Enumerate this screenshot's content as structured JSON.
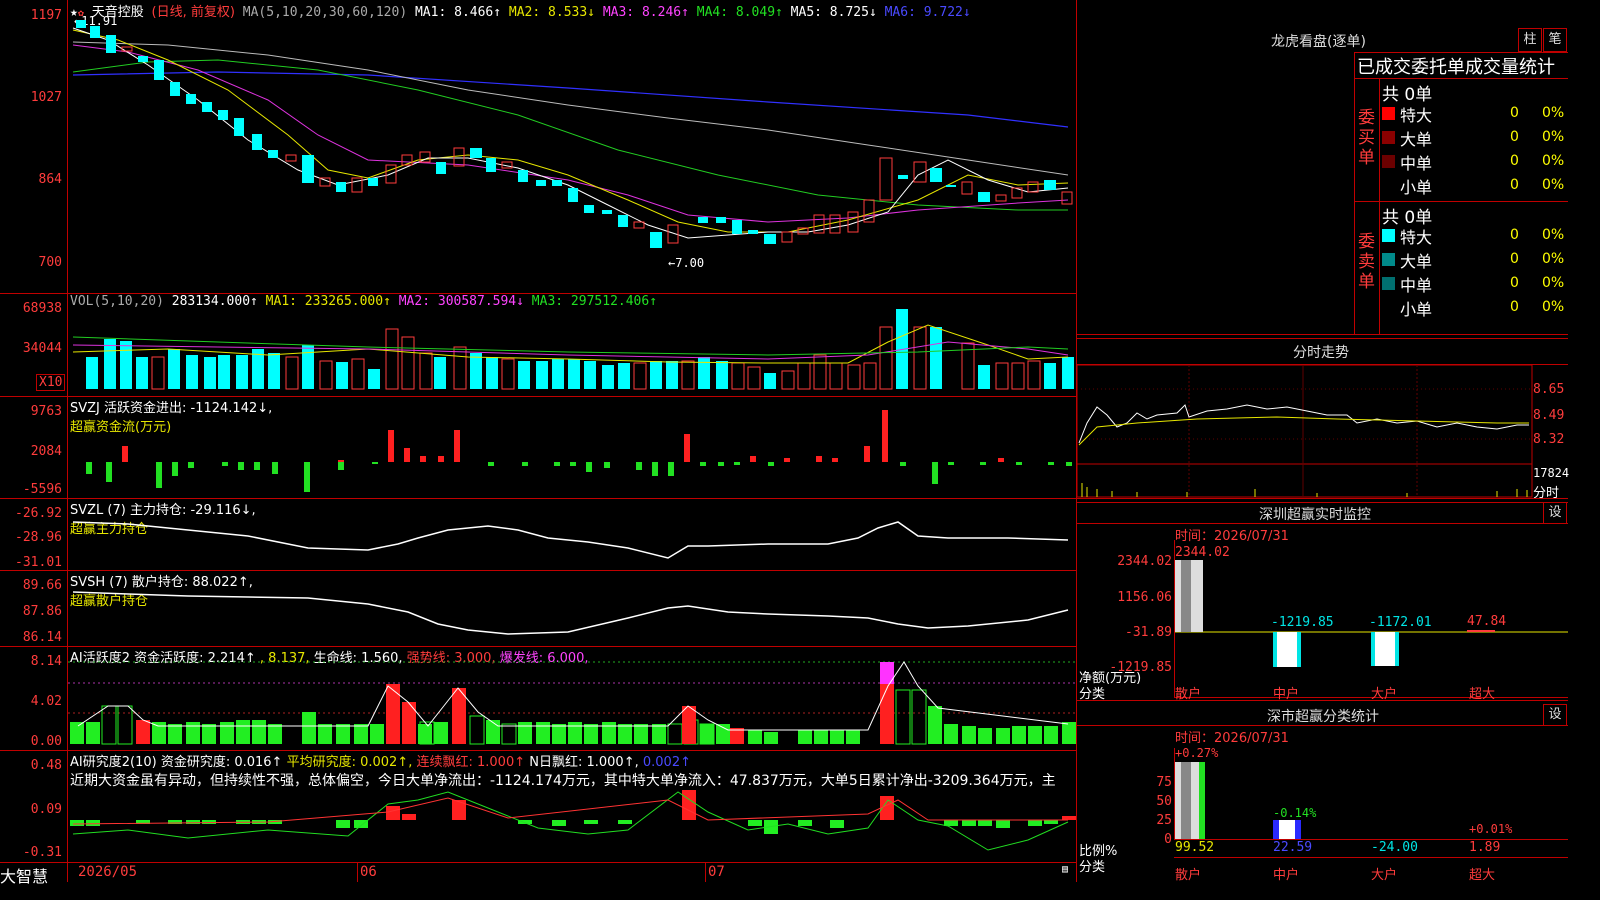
{
  "kline": {
    "star_icon": "star-icon",
    "stock_name": "天音控股",
    "period": "(日线, 前复权)",
    "ma_label": "MA(5,10,20,30,60,120)",
    "ma1": "MA1: 8.466↑",
    "ma2": "MA2: 8.533↓",
    "ma3": "MA3: 8.246↑",
    "ma4": "MA4: 8.049↑",
    "ma5": "MA5: 8.725↓",
    "ma6": "MA6: 9.722↓",
    "high_mark": "←11.91",
    "low_mark": "←7.00",
    "y_labels": [
      "1197",
      "1027",
      "864",
      "700"
    ]
  },
  "vol": {
    "label": "VOL(5,10,20)",
    "value": "283134.000↑",
    "ma1": "MA1: 233265.000↑",
    "ma2": "MA2: 300587.594↓",
    "ma3": "MA3: 297512.406↑",
    "y_labels": [
      "68938",
      "34044"
    ],
    "unit": "X10"
  },
  "svzj": {
    "label": "SVZJ  活跃资金进出: -1124.142↓,",
    "sub": "超赢资金流(万元)",
    "y_labels": [
      "9763",
      "2084",
      "-5596"
    ]
  },
  "svzl": {
    "label": "SVZL (7) 主力持仓: -29.116↓,",
    "sub": "超赢主力持仓",
    "y_labels": [
      "-26.92",
      "-28.96",
      "-31.01"
    ]
  },
  "svsh": {
    "label": "SVSH (7) 散户持仓: 88.022↑,",
    "sub": "超赢散户持仓",
    "y_labels": [
      "89.66",
      "87.86",
      "86.14"
    ]
  },
  "ai_active": {
    "label": "AI活跃度2 资金活跃度: 2.214↑",
    "v2": ", 8.137,",
    "life": "生命线: 1.560,",
    "strong": "强势线: 3.000,",
    "burst": "爆发线: 6.000,",
    "y_labels": [
      "8.14",
      "4.02",
      "0.00"
    ]
  },
  "ai_research": {
    "label": "AI研究度2(10) 资金研究度: 0.016↑",
    "avg": "平均研究度: 0.002↑,",
    "lian": "连续飘红: 1.000↑",
    "nri": "N日飘红: 1.000↑,",
    "last": "0.002↑",
    "comment": "近期大资金虽有异动，但持续性不强，总体偏空，今日大单净流出：-1124.174万元，其中特大单净流入：47.837万元，大单5日累计净出-3209.364万元，主",
    "y_labels": [
      "0.48",
      "0.09",
      "-0.31"
    ]
  },
  "x_axis": {
    "brand": "大智慧",
    "labels": [
      "2026/05",
      "06",
      "07"
    ]
  },
  "longhu": {
    "title": "龙虎看盘(逐单)",
    "btn_bar": "柱",
    "btn_pen": "笔",
    "tab_title": "已成交委托单成交量统计",
    "buy_side": "委买单",
    "sell_side": "委卖单",
    "buy_total": "共 0单",
    "sell_total": "共 0单",
    "buy_rows": [
      {
        "label": "特大",
        "count": "0",
        "pct": "0%",
        "color": "#ff0000"
      },
      {
        "label": "大单",
        "count": "0",
        "pct": "0%",
        "color": "#8b0000"
      },
      {
        "label": "中单",
        "count": "0",
        "pct": "0%",
        "color": "#6b0000"
      },
      {
        "label": "小单",
        "count": "0",
        "pct": "0%",
        "color": "#000000"
      }
    ],
    "sell_rows": [
      {
        "label": "特大",
        "count": "0",
        "pct": "0%",
        "color": "#00ffff"
      },
      {
        "label": "大单",
        "count": "0",
        "pct": "0%",
        "color": "#008b8b"
      },
      {
        "label": "中单",
        "count": "0",
        "pct": "0%",
        "color": "#007070"
      },
      {
        "label": "小单",
        "count": "0",
        "pct": "0%",
        "color": "#000000"
      }
    ]
  },
  "intraday": {
    "title": "分时走势",
    "y_labels": [
      "8.65",
      "8.49",
      "8.32"
    ],
    "vol_label": "17824",
    "unit": "分时"
  },
  "sz_monitor": {
    "title": "深圳超赢实时监控",
    "btn": "设",
    "time": "时间：2026/07/31",
    "y_labels": [
      "2344.02",
      "1156.06",
      "-31.89",
      "-1219.85"
    ],
    "axis_title": "净额(万元)",
    "axis_sub": "分类",
    "categories": [
      "散户",
      "中户",
      "大户",
      "超大"
    ],
    "values": [
      "2344.02",
      "-1219.85",
      "-1172.01",
      "47.84"
    ]
  },
  "sz_class": {
    "title": "深市超赢分类统计",
    "btn": "设",
    "time": "时间：2026/07/31",
    "y_labels": [
      "75",
      "50",
      "25",
      "0"
    ],
    "axis_title": "比例%",
    "axis_sub": "分类",
    "categories": [
      "散户",
      "中户",
      "大户",
      "超大"
    ],
    "pct_top": [
      "+0.27%",
      "-0.14%",
      "",
      "+0.01%"
    ],
    "values": [
      "99.52",
      "22.59",
      "-24.00",
      "1.89"
    ]
  }
}
